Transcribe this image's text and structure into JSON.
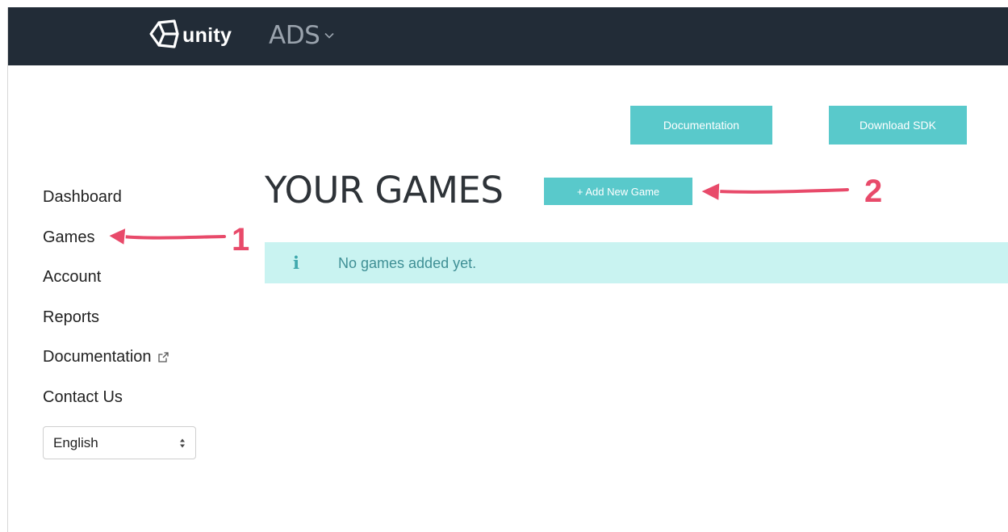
{
  "header": {
    "logo_text": "unity",
    "product_name": "ADS",
    "product_menu_icon": "chevron-down-icon",
    "background_color": "#222c37"
  },
  "actions": {
    "documentation_label": "Documentation",
    "download_sdk_label": "Download SDK",
    "add_game_label": "+ Add New Game",
    "button_color": "#59c9cb"
  },
  "main": {
    "title": "YOUR GAMES",
    "info": {
      "icon": "info-icon",
      "icon_glyph": "i",
      "message": "No games added yet.",
      "background_color": "#c9f3f1"
    }
  },
  "sidebar": {
    "items": [
      {
        "label": "Dashboard"
      },
      {
        "label": "Games"
      },
      {
        "label": "Account"
      },
      {
        "label": "Reports"
      },
      {
        "label": "Documentation",
        "icon": "external-link-icon"
      },
      {
        "label": "Contact Us"
      }
    ],
    "language": {
      "selected": "English",
      "icon": "select-arrows-icon"
    }
  },
  "annotations": [
    {
      "number": "1",
      "points_to": "Games",
      "color": "#e84a6a"
    },
    {
      "number": "2",
      "points_to": "+ Add New Game",
      "color": "#e84a6a"
    }
  ]
}
